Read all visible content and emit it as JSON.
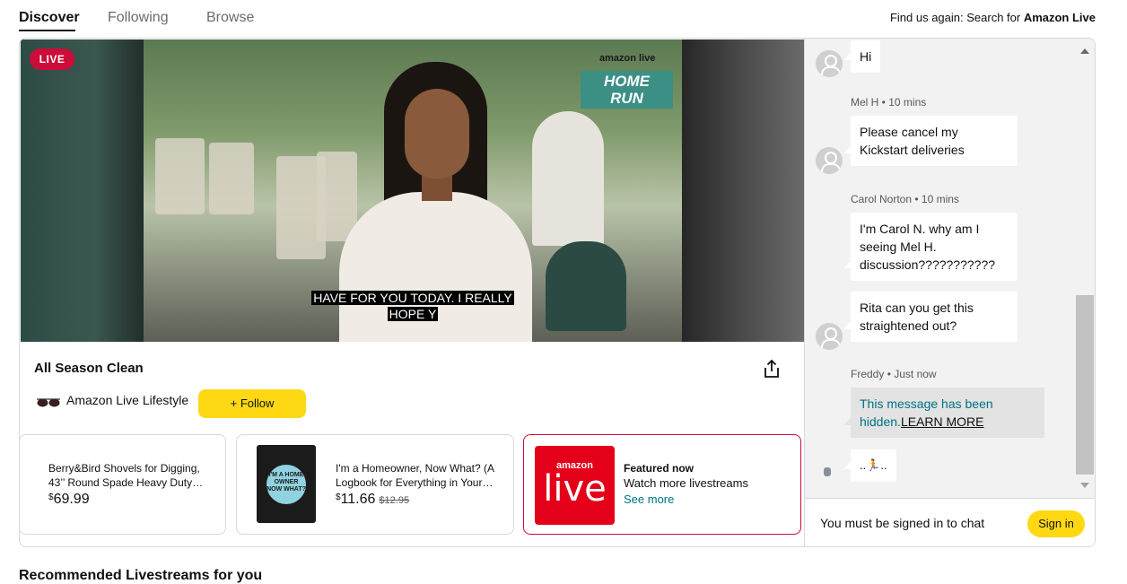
{
  "nav": {
    "tabs": [
      {
        "label": "Discover",
        "active": true
      },
      {
        "label": "Following",
        "active": false
      },
      {
        "label": "Browse",
        "active": false
      }
    ],
    "find_prefix": "Find us again: Search for ",
    "find_brand": "Amazon Live"
  },
  "video": {
    "live_badge": "LIVE",
    "brand_small": "amazon live",
    "show_logo_line1": "HOME",
    "show_logo_line2": "RUN",
    "caption_line1": "HAVE FOR YOU TODAY. I REALLY",
    "caption_line2": "HOPE Y"
  },
  "show": {
    "title": "All Season Clean",
    "channel": "Amazon Live Lifestyle",
    "follow_label": "+ Follow"
  },
  "products": [
    {
      "title": "Berry&Bird Shovels for Digging, 43’’ Round Spade Heavy Duty…",
      "currency": "$",
      "price": "69.99",
      "old_price": ""
    },
    {
      "title": "I'm a Homeowner, Now What? (A Logbook for Everything in Your…",
      "currency": "$",
      "price": "11.66",
      "old_price": "$12.95",
      "cover_text": "I'M A HOME OWNER NOW WHAT?"
    }
  ],
  "featured": {
    "logo_top": "amazon",
    "logo_main": "live",
    "heading": "Featured now",
    "subtitle": "Watch more livestreams",
    "link": "See more"
  },
  "chat": {
    "messages": [
      {
        "author": "",
        "time": "",
        "text": "Hi"
      },
      {
        "author": "Mel H",
        "time": "10 mins",
        "text_line1": "Please cancel my",
        "text_line2": "Kickstart deliveries"
      },
      {
        "author": "Carol Norton",
        "time": "10 mins",
        "text_line1": "I'm Carol N. why am I",
        "text_line2": "seeing Mel H.",
        "text_line3": "discussion???????????"
      },
      {
        "author": "",
        "time": "",
        "text_line1": "Rita can you get this",
        "text_line2": "straightened out?"
      },
      {
        "author": "Freddy",
        "time": "Just now",
        "hidden_line1": "This message has been",
        "hidden_line2": "hidden.",
        "learn_more": "LEARN MORE"
      },
      {
        "author": "",
        "time": "",
        "text": "..🏃.."
      }
    ],
    "meta_separator": " • ",
    "signed_in_msg": "You must be signed in to chat",
    "signin_label": "Sign in"
  },
  "recommended_heading": "Recommended Livestreams for you",
  "colors": {
    "accent_yellow": "#ffd814",
    "live_red": "#cc0c39",
    "link_teal": "#007185",
    "show_logo_teal": "#3b8f84"
  },
  "icons": [
    "share-icon",
    "sunglasses-icon",
    "user-avatar-icon",
    "scroll-up-icon",
    "scroll-down-icon"
  ]
}
